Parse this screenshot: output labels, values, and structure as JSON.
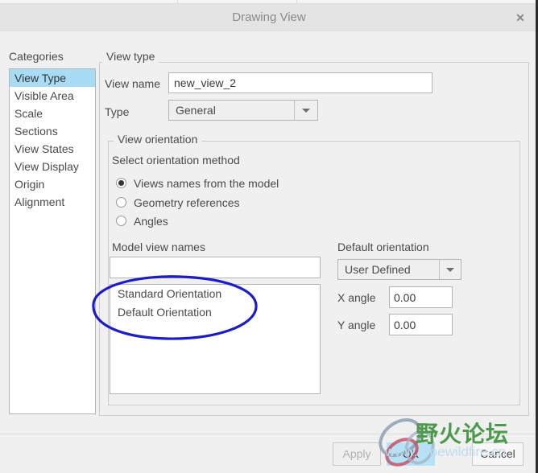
{
  "window": {
    "title": "Drawing View",
    "close_icon": "close-icon"
  },
  "categories": {
    "label": "Categories",
    "items": [
      {
        "label": "View Type",
        "selected": true
      },
      {
        "label": "Visible Area",
        "selected": false
      },
      {
        "label": "Scale",
        "selected": false
      },
      {
        "label": "Sections",
        "selected": false
      },
      {
        "label": "View States",
        "selected": false
      },
      {
        "label": "View Display",
        "selected": false
      },
      {
        "label": "Origin",
        "selected": false
      },
      {
        "label": "Alignment",
        "selected": false
      }
    ]
  },
  "view_type": {
    "legend": "View type",
    "view_name_label": "View name",
    "view_name_value": "new_view_2",
    "type_label": "Type",
    "type_value": "General",
    "type_options": [
      "General"
    ]
  },
  "view_orientation": {
    "legend": "View orientation",
    "select_method_label": "Select orientation method",
    "methods": [
      {
        "label": "Views names from the model",
        "checked": true
      },
      {
        "label": "Geometry references",
        "checked": false
      },
      {
        "label": "Angles",
        "checked": false
      }
    ],
    "model_view_names_label": "Model view names",
    "model_view_filter_value": "",
    "model_view_names": [
      "Standard Orientation",
      "Default Orientation"
    ],
    "default_orientation_label": "Default orientation",
    "default_orientation_value": "User Defined",
    "default_orientation_options": [
      "User Defined"
    ],
    "x_angle_label": "X angle",
    "x_angle_value": "0.00",
    "y_angle_label": "Y angle",
    "y_angle_value": "0.00"
  },
  "footer": {
    "apply_label": "Apply",
    "ok_label": "OK",
    "cancel_label": "Cancel"
  },
  "annotation": {
    "shape": "hand-drawn-ellipse",
    "color": "#1c1cc8",
    "target": "model view names list entries"
  },
  "watermark": {
    "text_cn": "野火论坛",
    "url": "www.proewildfire.cn",
    "logo": "interlocking-rings-logo",
    "text_color": "#4c9a4c",
    "url_color": "#bfdcef"
  },
  "colors": {
    "selection_blue": "#a8dcf5",
    "dialog_bg": "#f0f0f0",
    "titlebar_bg": "#e4e4e4",
    "border": "#b4b4b4"
  }
}
